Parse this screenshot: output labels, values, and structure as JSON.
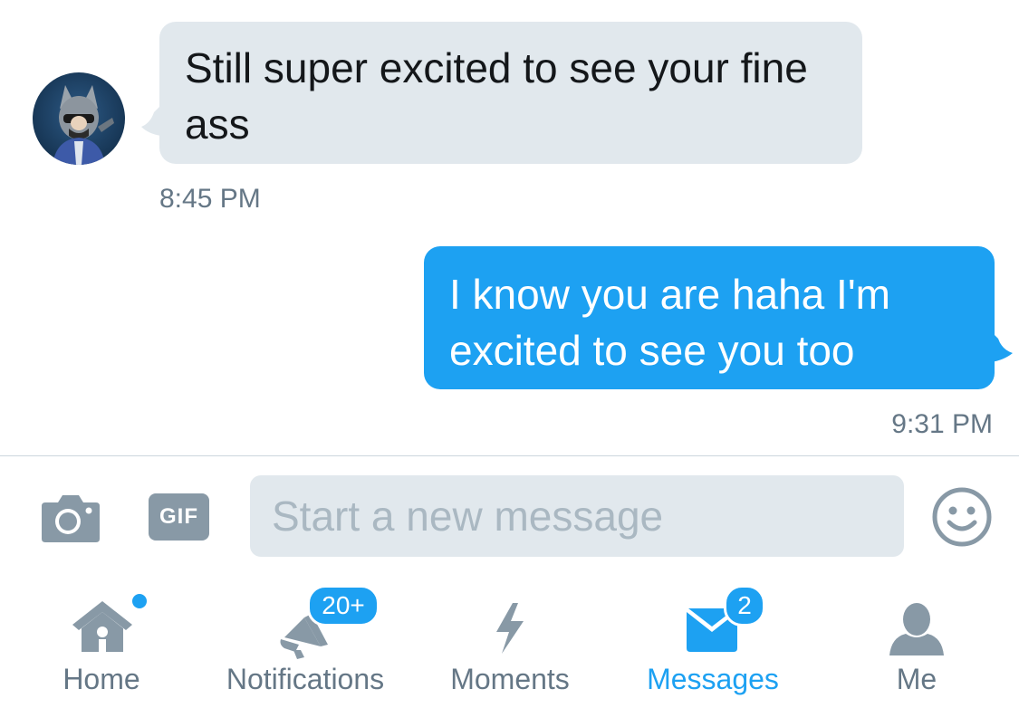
{
  "conversation": {
    "incoming": {
      "text": "Still super excited to see your fine ass",
      "time": "8:45 PM"
    },
    "outgoing": {
      "text": "I know you are haha I'm excited to see you too",
      "time": "9:31 PM"
    }
  },
  "composer": {
    "gif_label": "GIF",
    "placeholder": "Start a new message",
    "value": ""
  },
  "tabbar": {
    "home": {
      "label": "Home",
      "has_dot": true
    },
    "notifications": {
      "label": "Notifications",
      "badge": "20+"
    },
    "moments": {
      "label": "Moments"
    },
    "messages": {
      "label": "Messages",
      "badge": "2",
      "active": true
    },
    "me": {
      "label": "Me"
    }
  },
  "colors": {
    "accent": "#1da1f2",
    "incoming_bubble": "#e1e8ed",
    "icon_gray": "#8899a6",
    "secondary_text": "#657786"
  },
  "icons": [
    "camera-icon",
    "gif-icon",
    "smiley-icon",
    "home-icon",
    "bell-icon",
    "lightning-icon",
    "envelope-icon",
    "person-icon"
  ]
}
